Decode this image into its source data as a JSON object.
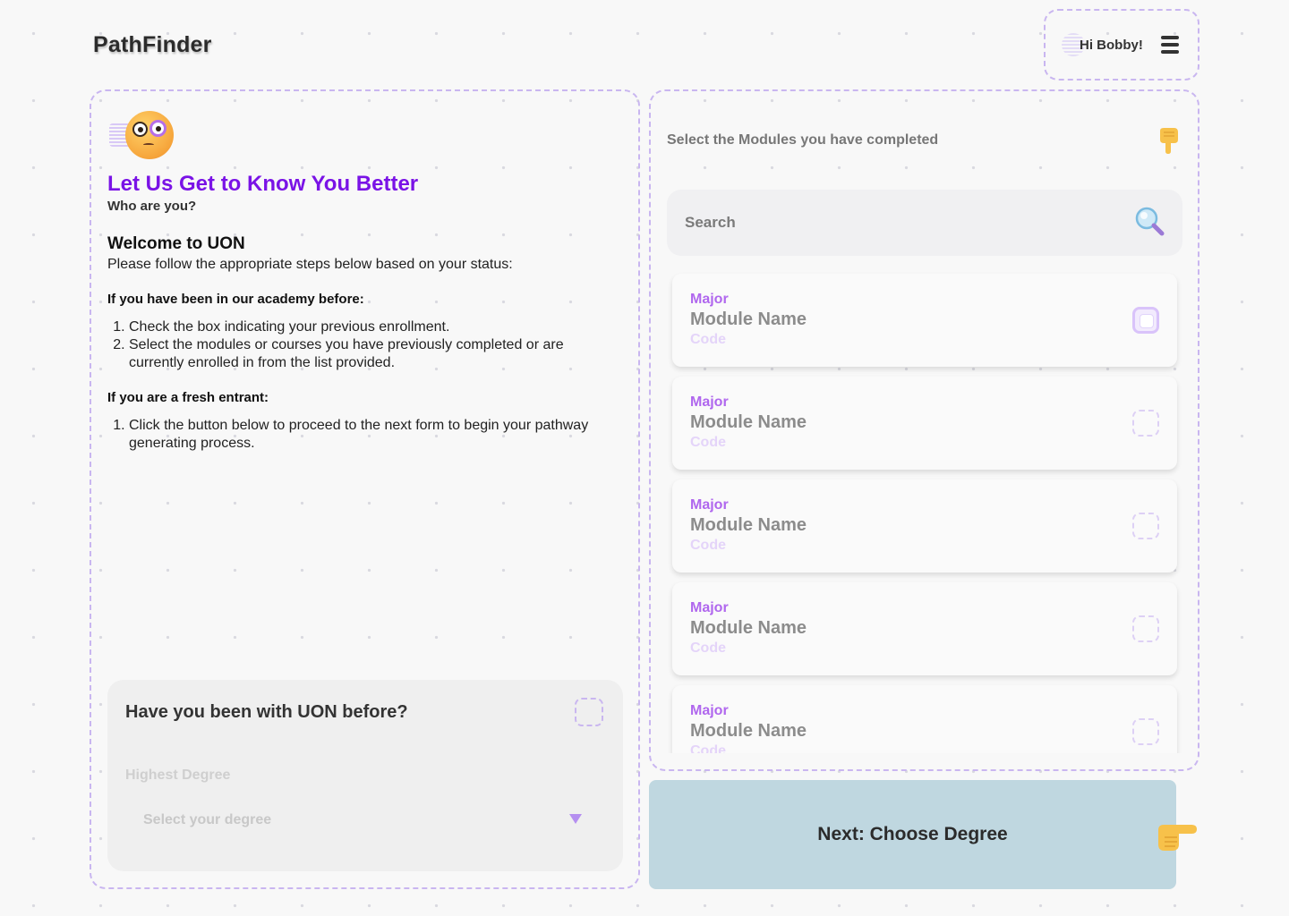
{
  "app": {
    "logo": "PathFinder"
  },
  "header": {
    "greeting": "Hi Bobby!",
    "menu_icon": "hamburger-menu-icon"
  },
  "left_panel": {
    "emoji_icon": "face-with-monocle-icon",
    "heading": "Let Us Get to Know You Better",
    "subheading": "Who are you?",
    "welcome_title": "Welcome to UON",
    "intro": "Please follow the appropriate steps below based on your status:",
    "returning_title": "If you have been in our academy before:",
    "returning_steps": [
      "Check the box indicating your previous enrollment.",
      "Select the modules or courses you have previously completed or are currently enrolled in from the list provided."
    ],
    "fresh_title": "If you are a fresh entrant:",
    "fresh_steps": [
      "Click the button below to proceed to the next form to begin your pathway generating process."
    ],
    "question": {
      "text": "Have you been with UON before?",
      "checked": false,
      "degree_label": "Highest Degree",
      "degree_placeholder": "Select your degree"
    }
  },
  "right_panel": {
    "title": "Select the Modules you have completed",
    "title_icon": "pointing-down-hand-icon",
    "search": {
      "placeholder": "Search",
      "value": "",
      "icon": "magnifying-glass-icon"
    },
    "modules": [
      {
        "major": "Major",
        "name": "Module Name",
        "code": "Code",
        "checked": true
      },
      {
        "major": "Major",
        "name": "Module Name",
        "code": "Code",
        "checked": false
      },
      {
        "major": "Major",
        "name": "Module Name",
        "code": "Code",
        "checked": false
      },
      {
        "major": "Major",
        "name": "Module Name",
        "code": "Code",
        "checked": false
      },
      {
        "major": "Major",
        "name": "Module Name",
        "code": "Code",
        "checked": false
      }
    ]
  },
  "next_button": {
    "label": "Next: Choose Degree",
    "icon": "pointing-right-hand-icon"
  },
  "colors": {
    "accent": "#7a13e6",
    "border": "#c9b6f0",
    "button": "#bfd7e0"
  }
}
